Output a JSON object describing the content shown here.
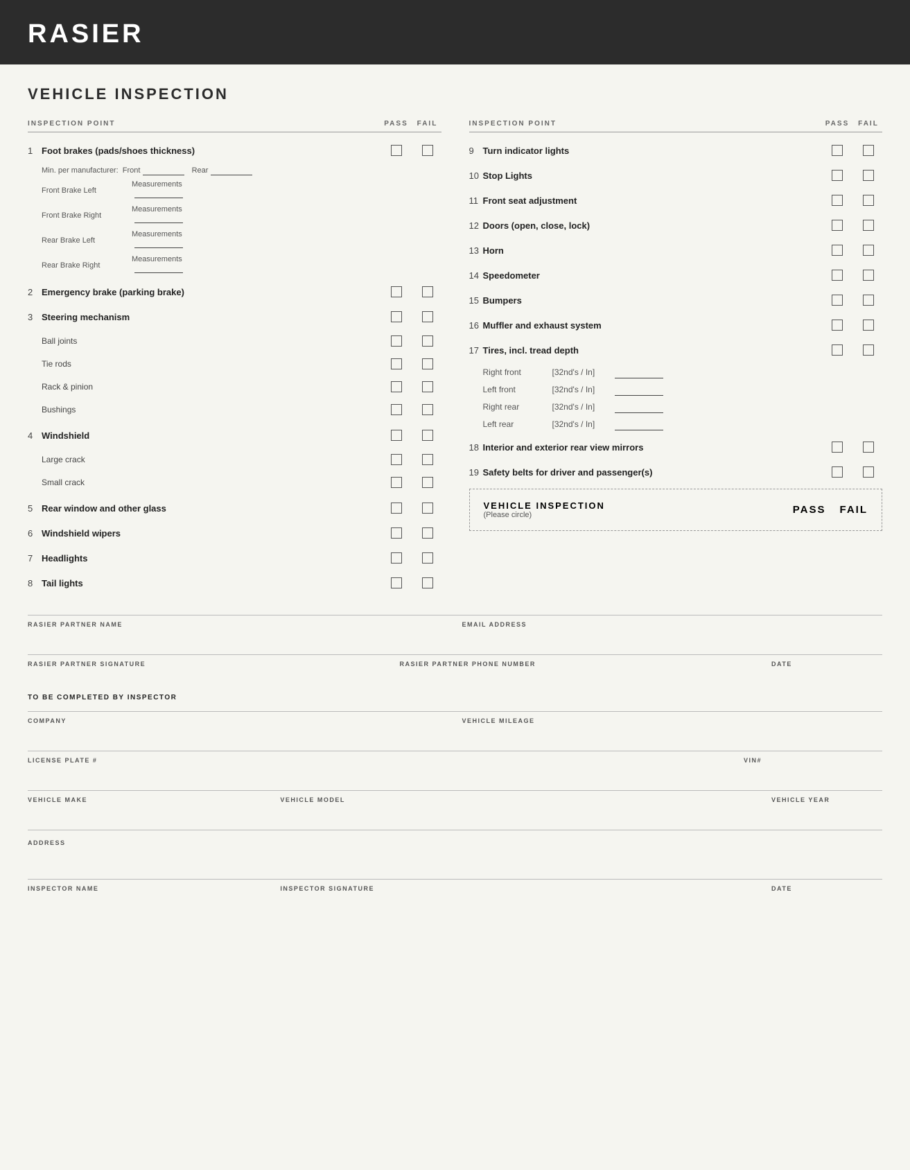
{
  "header": {
    "title": "RASIER"
  },
  "main": {
    "section_title": "VEHICLE INSPECTION",
    "col_headers": {
      "inspection_point": "INSPECTION POINT",
      "pass": "PASS",
      "fail": "FAIL"
    },
    "left_column": [
      {
        "number": "1",
        "label": "Foot brakes (pads/shoes thickness)",
        "bold": true,
        "has_checkbox": true,
        "sub_items": [
          {
            "type": "min_row",
            "text": "Min. per manufacturer:",
            "front_label": "Front",
            "rear_label": "Rear"
          },
          {
            "type": "measurement",
            "label": "Front Brake Left",
            "value": "Measurements"
          },
          {
            "type": "measurement",
            "label": "Front Brake Right",
            "value": "Measurements"
          },
          {
            "type": "measurement",
            "label": "Rear Brake Left",
            "value": "Measurements"
          },
          {
            "type": "measurement",
            "label": "Rear Brake Right",
            "value": "Measurements"
          }
        ]
      },
      {
        "number": "2",
        "label": "Emergency brake (parking brake)",
        "bold": true,
        "has_checkbox": true
      },
      {
        "number": "3",
        "label": "Steering mechanism",
        "bold": true,
        "has_checkbox": true,
        "sub_items": [
          {
            "type": "sub",
            "label": "Ball joints",
            "has_checkbox": true
          },
          {
            "type": "sub",
            "label": "Tie rods",
            "has_checkbox": true
          },
          {
            "type": "sub",
            "label": "Rack & pinion",
            "has_checkbox": true
          },
          {
            "type": "sub",
            "label": "Bushings",
            "has_checkbox": true
          }
        ]
      },
      {
        "number": "4",
        "label": "Windshield",
        "bold": true,
        "has_checkbox": true,
        "sub_items": [
          {
            "type": "sub",
            "label": "Large crack",
            "has_checkbox": true
          },
          {
            "type": "sub",
            "label": "Small crack",
            "has_checkbox": true
          }
        ]
      },
      {
        "number": "5",
        "label": "Rear window and other glass",
        "bold": true,
        "has_checkbox": true
      },
      {
        "number": "6",
        "label": "Windshield wipers",
        "bold": true,
        "has_checkbox": true
      },
      {
        "number": "7",
        "label": "Headlights",
        "bold": true,
        "has_checkbox": true
      },
      {
        "number": "8",
        "label": "Tail lights",
        "bold": true,
        "has_checkbox": true
      }
    ],
    "right_column": [
      {
        "number": "9",
        "label": "Turn indicator lights",
        "bold": true,
        "has_checkbox": true
      },
      {
        "number": "10",
        "label": "Stop Lights",
        "bold": true,
        "has_checkbox": true
      },
      {
        "number": "11",
        "label": "Front seat adjustment",
        "bold": true,
        "has_checkbox": true
      },
      {
        "number": "12",
        "label": "Doors (open, close, lock)",
        "bold": true,
        "has_checkbox": true
      },
      {
        "number": "13",
        "label": "Horn",
        "bold": true,
        "has_checkbox": true
      },
      {
        "number": "14",
        "label": "Speedometer",
        "bold": true,
        "has_checkbox": true
      },
      {
        "number": "15",
        "label": "Bumpers",
        "bold": true,
        "has_checkbox": true
      },
      {
        "number": "16",
        "label": "Muffler and exhaust system",
        "bold": true,
        "has_checkbox": true
      },
      {
        "number": "17",
        "label": "Tires, incl. tread depth",
        "bold": true,
        "has_checkbox": true,
        "tires": [
          {
            "label": "Right front",
            "unit": "[32nd's / In]"
          },
          {
            "label": "Left front",
            "unit": "[32nd's / In]"
          },
          {
            "label": "Right rear",
            "unit": "[32nd's / In]"
          },
          {
            "label": "Left rear",
            "unit": "[32nd's / In]"
          }
        ]
      },
      {
        "number": "18",
        "label": "Interior and exterior rear view mirrors",
        "bold": true,
        "has_checkbox": true
      },
      {
        "number": "19",
        "label": "Safety belts for driver and passenger(s)",
        "bold": true,
        "has_checkbox": true
      }
    ],
    "summary_box": {
      "title": "VEHICLE INSPECTION",
      "subtitle": "(Please circle)",
      "pass_label": "PASS",
      "fail_label": "FAIL"
    }
  },
  "form": {
    "partner_name_label": "RASIER PARTNER NAME",
    "email_label": "EMAIL ADDRESS",
    "signature_label": "RASIER PARTNER SIGNATURE",
    "phone_label": "RASIER PARTNER PHONE NUMBER",
    "date_label": "DATE",
    "to_be_completed": "TO BE COMPLETED BY INSPECTOR",
    "company_label": "COMPANY",
    "mileage_label": "VEHICLE MILEAGE",
    "license_label": "LICENSE PLATE #",
    "vin_label": "VIN#",
    "make_label": "VEHICLE MAKE",
    "model_label": "VEHICLE MODEL",
    "year_label": "VEHICLE YEAR",
    "address_label": "ADDRESS",
    "inspector_name_label": "INSPECTOR NAME",
    "inspector_sig_label": "INSPECTOR SIGNATURE",
    "inspector_date_label": "DATE"
  }
}
